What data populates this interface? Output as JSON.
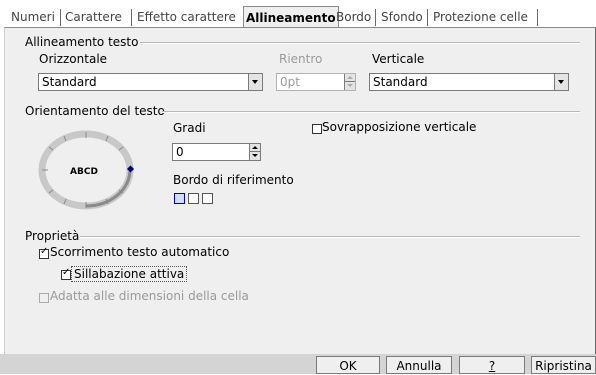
{
  "tabs": [
    {
      "label": "Numeri"
    },
    {
      "label": "Carattere"
    },
    {
      "label": "Effetto carattere"
    },
    {
      "label": "Allineamento"
    },
    {
      "label": "Bordo"
    },
    {
      "label": "Sfondo"
    },
    {
      "label": "Protezione celle"
    }
  ],
  "text_alignment": {
    "title": "Allineamento testo",
    "horizontal_label": "Orizzontale",
    "horizontal_value": "Standard",
    "indent_label": "Rientro",
    "indent_value": "0pt",
    "vertical_label": "Verticale",
    "vertical_value": "Standard"
  },
  "orientation": {
    "title": "Orientamento del testo",
    "dial_text": "ABCD",
    "degrees_label": "Gradi",
    "degrees_value": "0",
    "reference_edge_label": "Bordo di riferimento",
    "vertical_stacking_label": "Sovrapposizione verticale",
    "vertical_stacking_checked": false
  },
  "properties": {
    "title": "Proprietà",
    "wrap_label": "Scorrimento testo automatico",
    "wrap_checked": true,
    "hyphenation_label": "Sillabazione attiva",
    "hyphenation_checked": true,
    "shrink_label": "Adatta alle dimensioni della cella",
    "shrink_checked": false
  },
  "buttons": {
    "ok": "OK",
    "cancel": "Annulla",
    "help": "?",
    "reset": "Ripristina"
  },
  "colors": {
    "dialog_bg": "#efefef",
    "dial_marker": "#00007f"
  }
}
